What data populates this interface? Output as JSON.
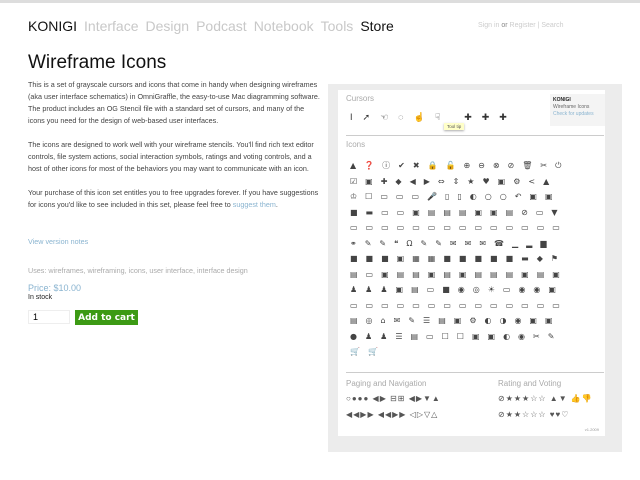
{
  "nav": {
    "brand": "KONIGI",
    "items": [
      "Interface",
      "Design",
      "Podcast",
      "Notebook",
      "Tools"
    ],
    "store": "Store",
    "sign_in": "Sign in",
    "or": "or",
    "register": "Register",
    "sep": "|",
    "search": "Search"
  },
  "product": {
    "title": "Wireframe Icons",
    "paragraphs": [
      "This is a set of grayscale cursors and icons that come in handy when designing wireframes (aka user interface schematics) in OmniGraffle, the easy-to-use Mac diagramming software. The product includes an OG Stencil file with a standard set of cursors, and many of the icons you need for the design of web-based user interfaces.",
      "The icons are designed to work well with your wireframe stencils. You'll find rich text editor controls, file system actions, social interaction symbols, ratings and voting controls, and a host of other icons for most of the behaviors you may want to communicate with an icon."
    ],
    "p3": "Your purchase of this icon set entitles you to free upgrades forever. If you have suggestions for icons you'd like to see included in this set, please feel free to ",
    "suggest_link": "suggest them",
    "p3_end": ".",
    "version_notes": "View version notes",
    "uses": "Uses: wireframes, wireframing, icons, user interface, interface design",
    "price": "Price: $10.00",
    "stock": "In stock",
    "quantity": "1",
    "add_to_cart": "Add to cart"
  },
  "preview": {
    "cursors_title": "Cursors",
    "cursors": [
      "I",
      "➚",
      "☜",
      "◌",
      "☝",
      "☟",
      "✚",
      "✚",
      "✚"
    ],
    "tooltip": "Tool tip",
    "konigi_title": "KONIGI",
    "konigi_sub": "Wireframe Icons",
    "konigi_link": "Check for updates",
    "icons_title": "Icons",
    "icon_rows": [
      "▲❓ⓘ✔✖🔒🔓⊕⊖⊗⊘🗑✂⏻",
      "☑▣✚◆◀▶⇔⇕★♥▣⚙<▲",
      "♔☐▭▭▭🎤▯▯◐○○↶▣▣",
      "■▬▭▭▣▤▤▤▣▣▤⊘▭▼",
      "▭▭▭▭▭▭▭▭▭▭▭▭▭▭",
      "⚭✎✎❝Ω✎✎✉✉✉☎▁▂▆",
      "■■■▣▦▦■■■■■▬◆⚑",
      "▤▭▣▤▤▣▤▣▤▤▤▣▤▣",
      "♟♟♟▣▤▭■◉◎☀▭◉◉▣",
      "▭▭▭▭▭▭▭▭▭▭▭▭▭▭",
      "▤◎⌂✉✎☰▤▣⚙◐◑◉▣▣",
      "●♟♟☰▤▭☐☐▣▣◐◉✂✎",
      "🛒🛒"
    ],
    "paging_title": "Paging and Navigation",
    "paging_row1": "○●●●  ◀▶  ⊟⊞  ◀▶▼▲",
    "paging_row2": "◀◀▶▶  ◀◀▶▶  ◁▷▽△",
    "rating_title": "Rating and Voting",
    "rating_row1": "⊘★★★☆☆  ▲▼ 👍👎",
    "rating_row2": "⊘★★☆☆☆  ♥♥♡",
    "footer": "v1.2009"
  }
}
